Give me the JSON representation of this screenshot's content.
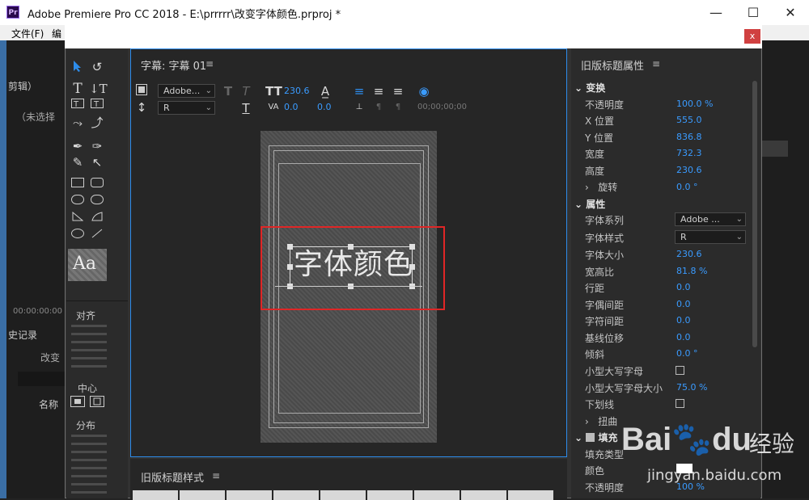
{
  "window": {
    "title": "Adobe Premiere Pro CC 2018 - E:\\prrrrr\\改变字体颜色.prproj *",
    "logo": "Pr",
    "minimize": "—",
    "maximize": "☐",
    "close": "✕"
  },
  "menubar": {
    "file": "文件(F)",
    "edit": "编"
  },
  "background_left": {
    "clip": "剪辑）",
    "no_select": "（未选择",
    "timecode": "00:00:00:00",
    "history": "史记录",
    "change": "改变",
    "name_col": "名称"
  },
  "dialog": {
    "close": "x"
  },
  "tools": {
    "align_label": "对齐",
    "center_label": "中心",
    "distribute_label": "分布",
    "style_sample": "Aa"
  },
  "canvas_panel": {
    "title": "字幕: 字幕 01",
    "font_family": "Adobe...",
    "font_style": "R",
    "font_size": "230.6",
    "kerning": "0.0",
    "leading": "0.0",
    "tracking": "0.0",
    "timecode": "00;00;00;00",
    "text": "字体颜色"
  },
  "styles_panel": {
    "title": "旧版标题样式"
  },
  "properties": {
    "title": "旧版标题属性",
    "transform": {
      "label": "变换",
      "opacity_label": "不透明度",
      "opacity": "100.0 %",
      "x_label": "X 位置",
      "x": "555.0",
      "y_label": "Y 位置",
      "y": "836.8",
      "width_label": "宽度",
      "width": "732.3",
      "height_label": "高度",
      "height": "230.6",
      "rotation_label": "旋转",
      "rotation": "0.0 °"
    },
    "attributes": {
      "label": "属性",
      "font_family_label": "字体系列",
      "font_family": "Adobe ...",
      "font_style_label": "字体样式",
      "font_style": "R",
      "font_size_label": "字体大小",
      "font_size": "230.6",
      "aspect_label": "宽高比",
      "aspect": "81.8 %",
      "leading_label": "行距",
      "leading": "0.0",
      "kerning_label": "字偶间距",
      "kerning": "0.0",
      "tracking_label": "字符间距",
      "tracking": "0.0",
      "baseline_label": "基线位移",
      "baseline": "0.0",
      "slant_label": "倾斜",
      "slant": "0.0 °",
      "small_caps_label": "小型大写字母",
      "small_caps_size_label": "小型大写字母大小",
      "small_caps_size": "75.0 %",
      "underline_label": "下划线",
      "distort_label": "扭曲"
    },
    "fill": {
      "label": "填充",
      "type_label": "填充类型",
      "color_label": "颜色",
      "opacity_label": "不透明度",
      "opacity": "100 %"
    }
  },
  "watermark": {
    "brand": "Bai",
    "brand2": "du",
    "sub": "经验",
    "url": "jingyan.baidu.com"
  },
  "colors": {
    "accent": "#3a9bff",
    "highlight": "#e02626",
    "selection": "#2d8ceb"
  }
}
